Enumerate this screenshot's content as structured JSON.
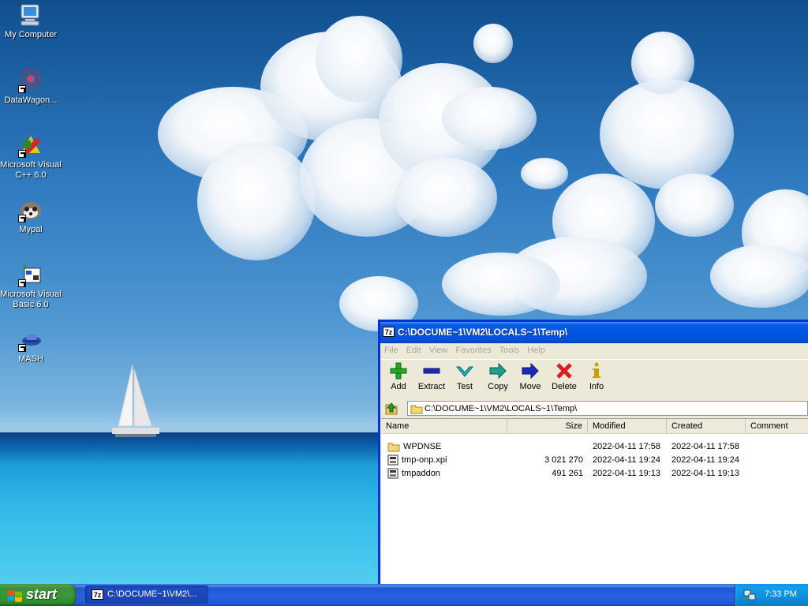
{
  "desktop": {
    "icons": [
      {
        "label": "My Computer",
        "icon": "my-computer-icon"
      },
      {
        "label": "DataWagon...",
        "icon": "datawagon-icon"
      },
      {
        "label": "Microsoft Visual C++ 6.0",
        "icon": "visual-cpp-icon"
      },
      {
        "label": "Mypal",
        "icon": "mypal-icon"
      },
      {
        "label": "Microsoft Visual Basic 6.0",
        "icon": "visual-basic-icon"
      },
      {
        "label": "MASH",
        "icon": "mash-icon"
      }
    ]
  },
  "window": {
    "title": "C:\\DOCUME~1\\VM2\\LOCALS~1\\Temp\\",
    "app_icon_text": "7z",
    "menu": [
      "File",
      "Edit",
      "View",
      "Favorites",
      "Tools",
      "Help"
    ],
    "toolbar": [
      {
        "label": "Add",
        "icon": "add-icon",
        "color": "#22aa22"
      },
      {
        "label": "Extract",
        "icon": "extract-icon",
        "color": "#1a2bb8"
      },
      {
        "label": "Test",
        "icon": "test-icon",
        "color": "#20b0c0"
      },
      {
        "label": "Copy",
        "icon": "copy-icon",
        "color": "#20a090"
      },
      {
        "label": "Move",
        "icon": "move-icon",
        "color": "#1a2bb8"
      },
      {
        "label": "Delete",
        "icon": "delete-icon",
        "color": "#d82020"
      },
      {
        "label": "Info",
        "icon": "info-icon",
        "color": "#c8a000"
      }
    ],
    "address": "C:\\DOCUME~1\\VM2\\LOCALS~1\\Temp\\",
    "columns": [
      "Name",
      "Size",
      "Modified",
      "Created",
      "Comment"
    ],
    "files": [
      {
        "name": "WPDNSE",
        "type": "folder",
        "size": "",
        "modified": "2022-04-11 17:58",
        "created": "2022-04-11 17:58"
      },
      {
        "name": "tmp-onp.xpi",
        "type": "file",
        "size": "3 021 270",
        "modified": "2022-04-11 19:24",
        "created": "2022-04-11 19:24"
      },
      {
        "name": "tmpaddon",
        "type": "file",
        "size": "491 261",
        "modified": "2022-04-11 19:13",
        "created": "2022-04-11 19:13"
      }
    ]
  },
  "taskbar": {
    "start_label": "start",
    "task_title": "C:\\DOCUME~1\\VM2\\...",
    "task_icon_text": "7z",
    "clock": "7:33 PM"
  }
}
